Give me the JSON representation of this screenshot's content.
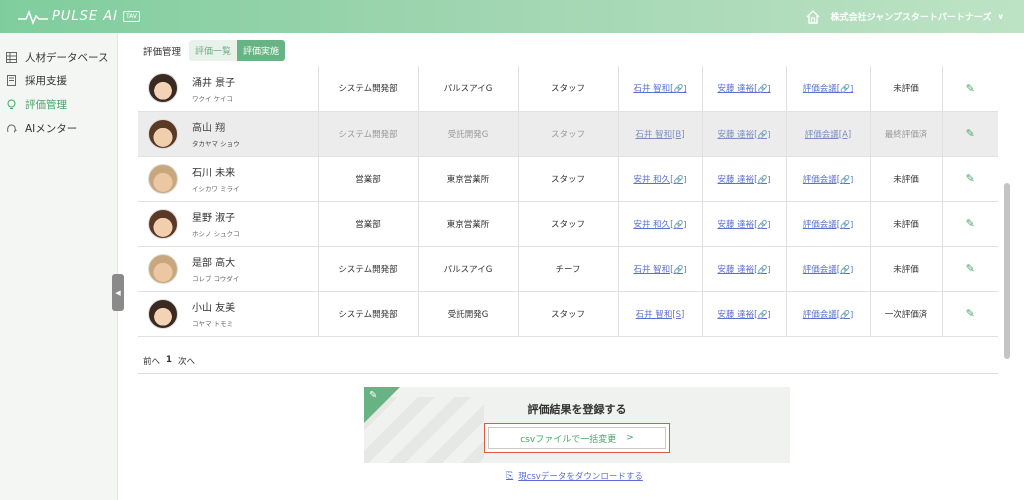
{
  "header": {
    "logo_text": "PULSE AI",
    "logo_badge": "TAV",
    "company_name": "株式会社ジャンプスタートパートナーズ",
    "colors": {
      "header_start": "#7fcd9d",
      "header_end": "#bde3c5",
      "accent": "#67b383"
    }
  },
  "sidebar": {
    "items": [
      {
        "label": "人材データベース",
        "icon": "grid-icon"
      },
      {
        "label": "採用支援",
        "icon": "document-icon"
      },
      {
        "label": "評価管理",
        "icon": "lightbulb-icon",
        "active": true
      },
      {
        "label": "AIメンター",
        "icon": "mentor-icon"
      }
    ]
  },
  "main": {
    "section_label": "評価管理",
    "tabs": [
      {
        "label": "評価一覧",
        "active": false
      },
      {
        "label": "評価実施",
        "active": true
      }
    ]
  },
  "table": {
    "rows": [
      {
        "name": "涌井 景子",
        "kana": "ワクイ ケイコ",
        "dept": "システム開発部",
        "group": "パルスアイG",
        "role": "スタッフ",
        "eval1": "石井 智和[",
        "eval2": "安藤 達裕[",
        "eval3": "評価会議[",
        "status": "未評価",
        "grey": false
      },
      {
        "name": "高山 翔",
        "kana": "タカヤマ ショウ",
        "dept": "システム開発部",
        "group": "受託開発G",
        "role": "スタッフ",
        "eval1": "石井 智和[B]",
        "eval2": "安藤 達裕[",
        "eval3": "評価会議[A]",
        "status": "最終評価済",
        "grey": true
      },
      {
        "name": "石川 未来",
        "kana": "イシカワ ミライ",
        "dept": "営業部",
        "group": "東京営業所",
        "role": "スタッフ",
        "eval1": "安井 和久[",
        "eval2": "安藤 達裕[",
        "eval3": "評価会議[",
        "status": "未評価",
        "grey": false
      },
      {
        "name": "星野 淑子",
        "kana": "ホシノ シュクコ",
        "dept": "営業部",
        "group": "東京営業所",
        "role": "スタッフ",
        "eval1": "安井 和久[",
        "eval2": "安藤 達裕[",
        "eval3": "評価会議[",
        "status": "未評価",
        "grey": false
      },
      {
        "name": "是部 高大",
        "kana": "コレブ コウダイ",
        "dept": "システム開発部",
        "group": "パルスアイG",
        "role": "チーフ",
        "eval1": "石井 智和[",
        "eval2": "安藤 達裕[",
        "eval3": "評価会議[",
        "status": "未評価",
        "grey": false
      },
      {
        "name": "小山 友美",
        "kana": "コヤマ トモミ",
        "dept": "システム開発部",
        "group": "受託開発G",
        "role": "スタッフ",
        "eval1": "石井 智和[S]",
        "eval2": "安藤 達裕[",
        "eval3": "評価会議[",
        "status": "一次評価済",
        "grey": false
      }
    ]
  },
  "pager": {
    "prev": "前へ",
    "current": "1",
    "next": "次へ"
  },
  "register": {
    "title": "評価結果を登録する",
    "csv_button": "csvファイルで一括変更",
    "csv_button_arrow": ">",
    "download_link": "現csvデータをダウンロードする"
  }
}
